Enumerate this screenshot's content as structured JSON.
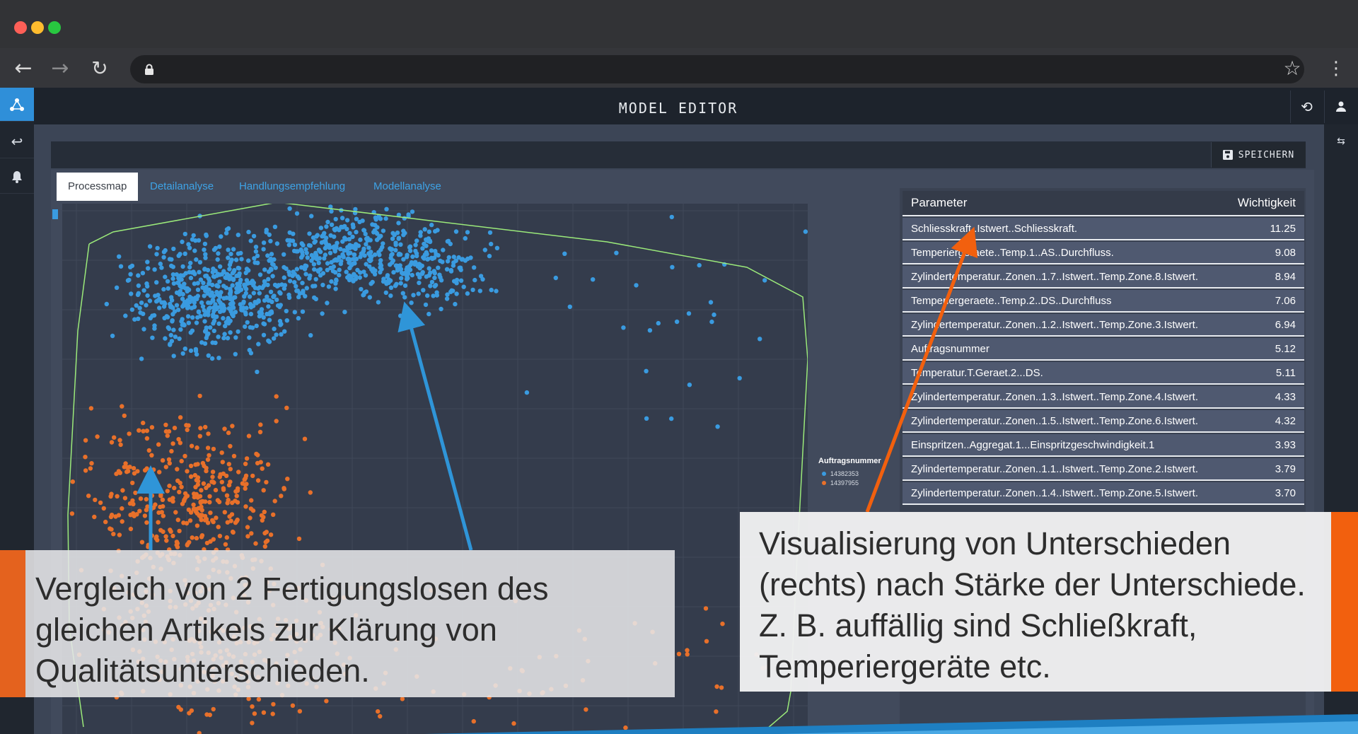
{
  "app": {
    "title": "MODEL EDITOR"
  },
  "toolbar": {
    "save_label": "SPEICHERN"
  },
  "tabs": [
    {
      "label": "Processmap",
      "active": true
    },
    {
      "label": "Detailanalyse",
      "active": false
    },
    {
      "label": "Handlungsempfehlung",
      "active": false
    },
    {
      "label": "Modellanalyse",
      "active": false
    }
  ],
  "legend": {
    "title": "Auftragsnummer",
    "items": [
      {
        "label": "14382353",
        "color": "#3a9be0"
      },
      {
        "label": "14397955",
        "color": "#e8702a"
      }
    ]
  },
  "table": {
    "headers": [
      "Parameter",
      "Wichtigkeit"
    ],
    "rows": [
      {
        "parameter": "Schliesskraft..Istwert..Schliesskraft.",
        "value": "11.25"
      },
      {
        "parameter": "Temperiergeraete..Temp.1..AS..Durchfluss.",
        "value": "9.08"
      },
      {
        "parameter": "Zylindertemperatur..Zonen..1.7..Istwert..Temp.Zone.8.Istwert.",
        "value": "8.94"
      },
      {
        "parameter": "Temperiergeraete..Temp.2..DS..Durchfluss",
        "value": "7.06"
      },
      {
        "parameter": "Zylindertemperatur..Zonen..1.2..Istwert..Temp.Zone.3.Istwert.",
        "value": "6.94"
      },
      {
        "parameter": "Auftragsnummer",
        "value": "5.12"
      },
      {
        "parameter": "Temperatur.T.Geraet.2...DS.",
        "value": "5.11"
      },
      {
        "parameter": "Zylindertemperatur..Zonen..1.3..Istwert..Temp.Zone.4.Istwert.",
        "value": "4.33"
      },
      {
        "parameter": "Zylindertemperatur..Zonen..1.5..Istwert..Temp.Zone.6.Istwert.",
        "value": "4.32"
      },
      {
        "parameter": "Einspritzen..Aggregat.1...Einspritzgeschwindigkeit.1",
        "value": "3.93"
      },
      {
        "parameter": "Zylindertemperatur..Zonen..1.1..Istwert..Temp.Zone.2.Istwert.",
        "value": "3.79"
      },
      {
        "parameter": "Zylindertemperatur..Zonen..1.4..Istwert..Temp.Zone.5.Istwert.",
        "value": "3.70"
      }
    ]
  },
  "callouts": {
    "left": "Vergleich von 2 Fertigungslosen des gleichen Artikels zur Klärung von Qualitätsunterschieden.",
    "right": "Visualisierung von Unterschieden (rechts) nach Stärke der Unterschiede. Z. B. auffällig sind Schließkraft, Temperiergeräte etc."
  },
  "icons": {
    "back": "arrow-left-icon",
    "forward": "arrow-right-icon",
    "reload": "reload-icon",
    "lock": "lock-icon",
    "bookmark": "star-icon",
    "menu": "kebab-menu-icon",
    "app": "network-icon",
    "undo": "undo-icon",
    "bell": "bell-icon",
    "refresh": "refresh-icon",
    "user": "user-icon",
    "save": "floppy-icon"
  },
  "colors": {
    "accent_blue": "#3ea3e6",
    "cluster_blue": "#3a9be0",
    "cluster_orange": "#e8702a",
    "hull_green": "#9bea7a",
    "callout_orange": "#f2600e"
  }
}
